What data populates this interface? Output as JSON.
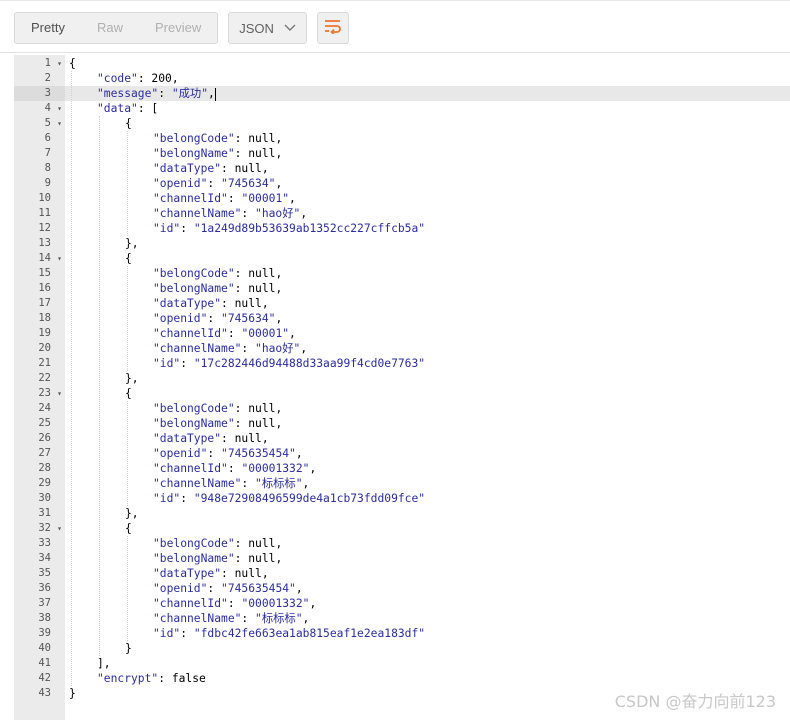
{
  "toolbar": {
    "views": [
      {
        "label": "Pretty",
        "active": true
      },
      {
        "label": "Raw",
        "active": false
      },
      {
        "label": "Preview",
        "active": false
      }
    ],
    "format": "JSON",
    "wrap_icon": "wrap-lines-icon"
  },
  "editor": {
    "active_line": 3,
    "lines": [
      {
        "n": "1",
        "fold": true
      },
      {
        "n": "2"
      },
      {
        "n": "3"
      },
      {
        "n": "4",
        "fold": true
      },
      {
        "n": "5",
        "fold": true
      },
      {
        "n": "6"
      },
      {
        "n": "7"
      },
      {
        "n": "8"
      },
      {
        "n": "9"
      },
      {
        "n": "10"
      },
      {
        "n": "11"
      },
      {
        "n": "12"
      },
      {
        "n": "13"
      },
      {
        "n": "14",
        "fold": true
      },
      {
        "n": "15"
      },
      {
        "n": "16"
      },
      {
        "n": "17"
      },
      {
        "n": "18"
      },
      {
        "n": "19"
      },
      {
        "n": "20"
      },
      {
        "n": "21"
      },
      {
        "n": "22"
      },
      {
        "n": "23",
        "fold": true
      },
      {
        "n": "24"
      },
      {
        "n": "25"
      },
      {
        "n": "26"
      },
      {
        "n": "27"
      },
      {
        "n": "28"
      },
      {
        "n": "29"
      },
      {
        "n": "30"
      },
      {
        "n": "31"
      },
      {
        "n": "32",
        "fold": true
      },
      {
        "n": "33"
      },
      {
        "n": "34"
      },
      {
        "n": "35"
      },
      {
        "n": "36"
      },
      {
        "n": "37"
      },
      {
        "n": "38"
      },
      {
        "n": "39"
      },
      {
        "n": "40"
      },
      {
        "n": "41"
      },
      {
        "n": "42"
      },
      {
        "n": "43"
      }
    ],
    "code": [
      {
        "indent": 0,
        "text": "{"
      },
      {
        "indent": 1,
        "key": "\"code\"",
        "val": "200",
        "vt": "n",
        "comma": true
      },
      {
        "indent": 1,
        "key": "\"message\"",
        "val": "\"成功\"",
        "vt": "s",
        "comma": true,
        "cursor": true
      },
      {
        "indent": 1,
        "key": "\"data\"",
        "val": "[",
        "vt": "p"
      },
      {
        "indent": 2,
        "text": "{"
      },
      {
        "indent": 3,
        "key": "\"belongCode\"",
        "val": "null",
        "vt": "n",
        "comma": true
      },
      {
        "indent": 3,
        "key": "\"belongName\"",
        "val": "null",
        "vt": "n",
        "comma": true
      },
      {
        "indent": 3,
        "key": "\"dataType\"",
        "val": "null",
        "vt": "n",
        "comma": true
      },
      {
        "indent": 3,
        "key": "\"openid\"",
        "val": "\"745634\"",
        "vt": "s",
        "comma": true
      },
      {
        "indent": 3,
        "key": "\"channelId\"",
        "val": "\"00001\"",
        "vt": "s",
        "comma": true
      },
      {
        "indent": 3,
        "key": "\"channelName\"",
        "val": "\"hao好\"",
        "vt": "s",
        "comma": true
      },
      {
        "indent": 3,
        "key": "\"id\"",
        "val": "\"1a249d89b53639ab1352cc227cffcb5a\"",
        "vt": "s"
      },
      {
        "indent": 2,
        "text": "},"
      },
      {
        "indent": 2,
        "text": "{"
      },
      {
        "indent": 3,
        "key": "\"belongCode\"",
        "val": "null",
        "vt": "n",
        "comma": true
      },
      {
        "indent": 3,
        "key": "\"belongName\"",
        "val": "null",
        "vt": "n",
        "comma": true
      },
      {
        "indent": 3,
        "key": "\"dataType\"",
        "val": "null",
        "vt": "n",
        "comma": true
      },
      {
        "indent": 3,
        "key": "\"openid\"",
        "val": "\"745634\"",
        "vt": "s",
        "comma": true
      },
      {
        "indent": 3,
        "key": "\"channelId\"",
        "val": "\"00001\"",
        "vt": "s",
        "comma": true
      },
      {
        "indent": 3,
        "key": "\"channelName\"",
        "val": "\"hao好\"",
        "vt": "s",
        "comma": true
      },
      {
        "indent": 3,
        "key": "\"id\"",
        "val": "\"17c282446d94488d33aa99f4cd0e7763\"",
        "vt": "s"
      },
      {
        "indent": 2,
        "text": "},"
      },
      {
        "indent": 2,
        "text": "{"
      },
      {
        "indent": 3,
        "key": "\"belongCode\"",
        "val": "null",
        "vt": "n",
        "comma": true
      },
      {
        "indent": 3,
        "key": "\"belongName\"",
        "val": "null",
        "vt": "n",
        "comma": true
      },
      {
        "indent": 3,
        "key": "\"dataType\"",
        "val": "null",
        "vt": "n",
        "comma": true
      },
      {
        "indent": 3,
        "key": "\"openid\"",
        "val": "\"745635454\"",
        "vt": "s",
        "comma": true
      },
      {
        "indent": 3,
        "key": "\"channelId\"",
        "val": "\"00001332\"",
        "vt": "s",
        "comma": true
      },
      {
        "indent": 3,
        "key": "\"channelName\"",
        "val": "\"标标标\"",
        "vt": "s",
        "comma": true
      },
      {
        "indent": 3,
        "key": "\"id\"",
        "val": "\"948e72908496599de4a1cb73fdd09fce\"",
        "vt": "s"
      },
      {
        "indent": 2,
        "text": "},"
      },
      {
        "indent": 2,
        "text": "{"
      },
      {
        "indent": 3,
        "key": "\"belongCode\"",
        "val": "null",
        "vt": "n",
        "comma": true
      },
      {
        "indent": 3,
        "key": "\"belongName\"",
        "val": "null",
        "vt": "n",
        "comma": true
      },
      {
        "indent": 3,
        "key": "\"dataType\"",
        "val": "null",
        "vt": "n",
        "comma": true
      },
      {
        "indent": 3,
        "key": "\"openid\"",
        "val": "\"745635454\"",
        "vt": "s",
        "comma": true
      },
      {
        "indent": 3,
        "key": "\"channelId\"",
        "val": "\"00001332\"",
        "vt": "s",
        "comma": true
      },
      {
        "indent": 3,
        "key": "\"channelName\"",
        "val": "\"标标标\"",
        "vt": "s",
        "comma": true
      },
      {
        "indent": 3,
        "key": "\"id\"",
        "val": "\"fdbc42fe663ea1ab815eaf1e2ea183df\"",
        "vt": "s"
      },
      {
        "indent": 2,
        "text": "}"
      },
      {
        "indent": 1,
        "text": "],"
      },
      {
        "indent": 1,
        "key": "\"encrypt\"",
        "val": "false",
        "vt": "n"
      },
      {
        "indent": 0,
        "text": "}"
      }
    ]
  },
  "watermark": "CSDN @奋力向前123"
}
